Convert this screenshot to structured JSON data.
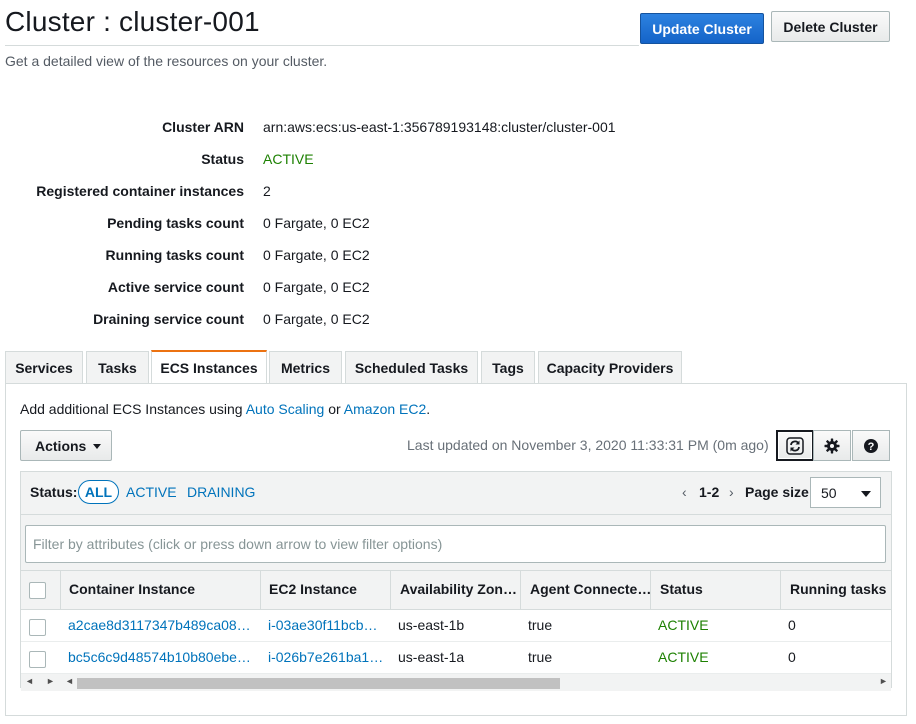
{
  "page": {
    "title": "Cluster : cluster-001",
    "subtitle": "Get a detailed view of the resources on your cluster.",
    "update_button": "Update Cluster",
    "delete_button": "Delete Cluster"
  },
  "details": [
    {
      "label": "Cluster ARN",
      "value": "arn:aws:ecs:us-east-1:356789193148:cluster/cluster-001"
    },
    {
      "label": "Status",
      "value": "ACTIVE"
    },
    {
      "label": "Registered container instances",
      "value": "2"
    },
    {
      "label": "Pending tasks count",
      "value": "0 Fargate, 0 EC2"
    },
    {
      "label": "Running tasks count",
      "value": "0 Fargate, 0 EC2"
    },
    {
      "label": "Active service count",
      "value": "0 Fargate, 0 EC2"
    },
    {
      "label": "Draining service count",
      "value": "0 Fargate, 0 EC2"
    }
  ],
  "tabs": [
    {
      "label": "Services"
    },
    {
      "label": "Tasks"
    },
    {
      "label": "ECS Instances",
      "selected": true
    },
    {
      "label": "Metrics"
    },
    {
      "label": "Scheduled Tasks"
    },
    {
      "label": "Tags"
    },
    {
      "label": "Capacity Providers"
    }
  ],
  "instances_panel": {
    "info_prefix": "Add additional ECS Instances using ",
    "info_link1": "Auto Scaling",
    "info_mid": " or ",
    "info_link2": "Amazon EC2",
    "info_suffix": ".",
    "actions_label": "Actions",
    "last_updated": "Last updated on November 3, 2020 11:33:31 PM (0m ago)",
    "icons": [
      "refresh-icon",
      "gear-icon",
      "help-icon"
    ],
    "status_label": "Status:",
    "status_filters": [
      "ALL",
      "ACTIVE",
      "DRAINING"
    ],
    "selected_filter": "ALL",
    "pager_range": "1-2",
    "page_size_label": "Page size",
    "page_size_value": "50",
    "filter_placeholder": "Filter by attributes (click or press down arrow to view filter options)",
    "columns": [
      "Container Instance",
      "EC2 Instance",
      "Availability Zon…",
      "Agent Connecte…",
      "Status",
      "Running tasks c"
    ],
    "rows": [
      {
        "container_instance": "a2cae8d3117347b489ca08…",
        "ec2_instance": "i-03ae30f11bcb…",
        "az": "us-east-1b",
        "agent": "true",
        "status": "ACTIVE",
        "running": "0"
      },
      {
        "container_instance": "bc5c6c9d48574b10b80ebe…",
        "ec2_instance": "i-026b7e261ba1…",
        "az": "us-east-1a",
        "agent": "true",
        "status": "ACTIVE",
        "running": "0"
      }
    ]
  },
  "colors": {
    "primary_button": "#1f6fd1",
    "link": "#0073bb",
    "active_status": "#1d8102",
    "selected_tab_accent": "#ec7211"
  }
}
